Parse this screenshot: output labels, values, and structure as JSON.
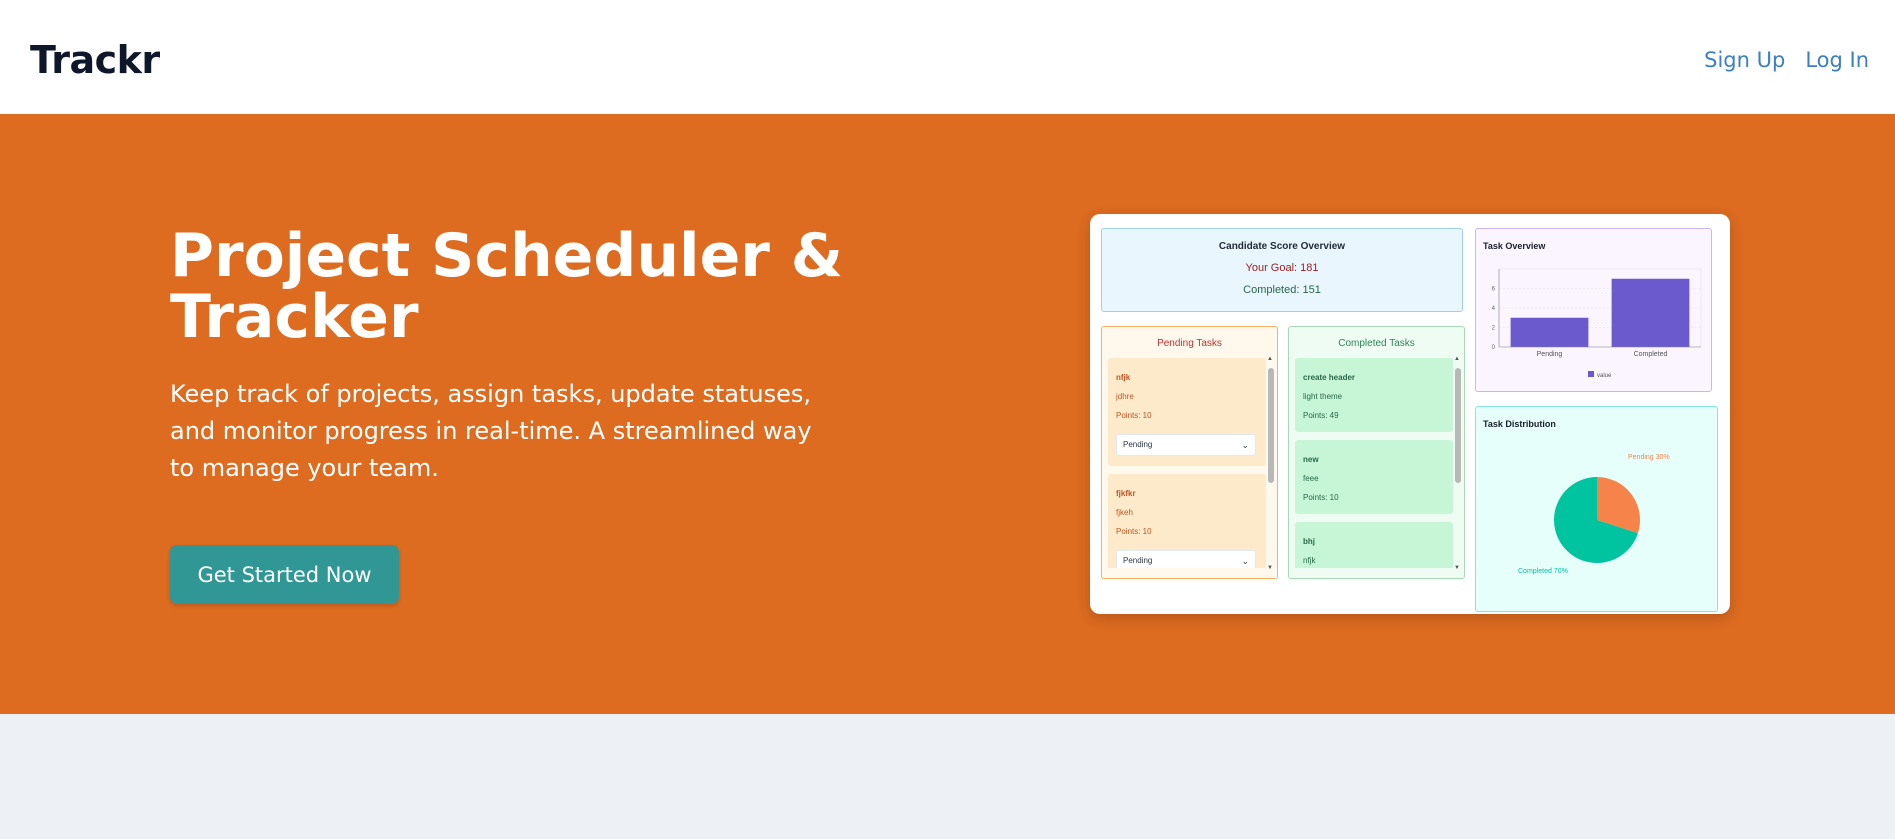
{
  "nav": {
    "brand": "Trackr",
    "signup": "Sign Up",
    "login": "Log In"
  },
  "hero": {
    "title": "Project Scheduler & Tracker",
    "description": "Keep track of projects, assign tasks, update statuses, and monitor progress in real-time. A streamlined way to manage your team.",
    "cta": "Get Started Now",
    "background_color": "#dd6b20",
    "cta_color": "#319795"
  },
  "preview": {
    "score": {
      "title": "Candidate Score Overview",
      "goal": "Your Goal: 181",
      "completed": "Completed: 151"
    },
    "pending": {
      "title": "Pending Tasks",
      "tasks": [
        {
          "name": "nfjk",
          "desc": "jdhre",
          "points": "Points: 10",
          "status": "Pending"
        },
        {
          "name": "fjkfkr",
          "desc": "fjkeh",
          "points": "Points: 10",
          "status": "Pending"
        }
      ]
    },
    "completed": {
      "title": "Completed Tasks",
      "tasks": [
        {
          "name": "create header",
          "desc": "light theme",
          "points": "Points: 49"
        },
        {
          "name": "new",
          "desc": "feee",
          "points": "Points: 10"
        },
        {
          "name": "bhj",
          "desc": "nfjk",
          "points": ""
        }
      ]
    }
  },
  "chart_data": [
    {
      "type": "bar",
      "title": "Task Overview",
      "categories": [
        "Pending",
        "Completed"
      ],
      "values": [
        3,
        7
      ],
      "ylim": [
        0,
        8
      ],
      "yticks": [
        "0",
        "2",
        "4",
        "6"
      ],
      "legend": "value",
      "grid": true,
      "color": "#6a5acd"
    },
    {
      "type": "pie",
      "title": "Task Distribution",
      "labels": [
        "Pending 30%",
        "Completed 70%"
      ],
      "values": [
        30,
        70
      ],
      "colors": [
        "#f6844a",
        "#00c49f"
      ]
    }
  ]
}
